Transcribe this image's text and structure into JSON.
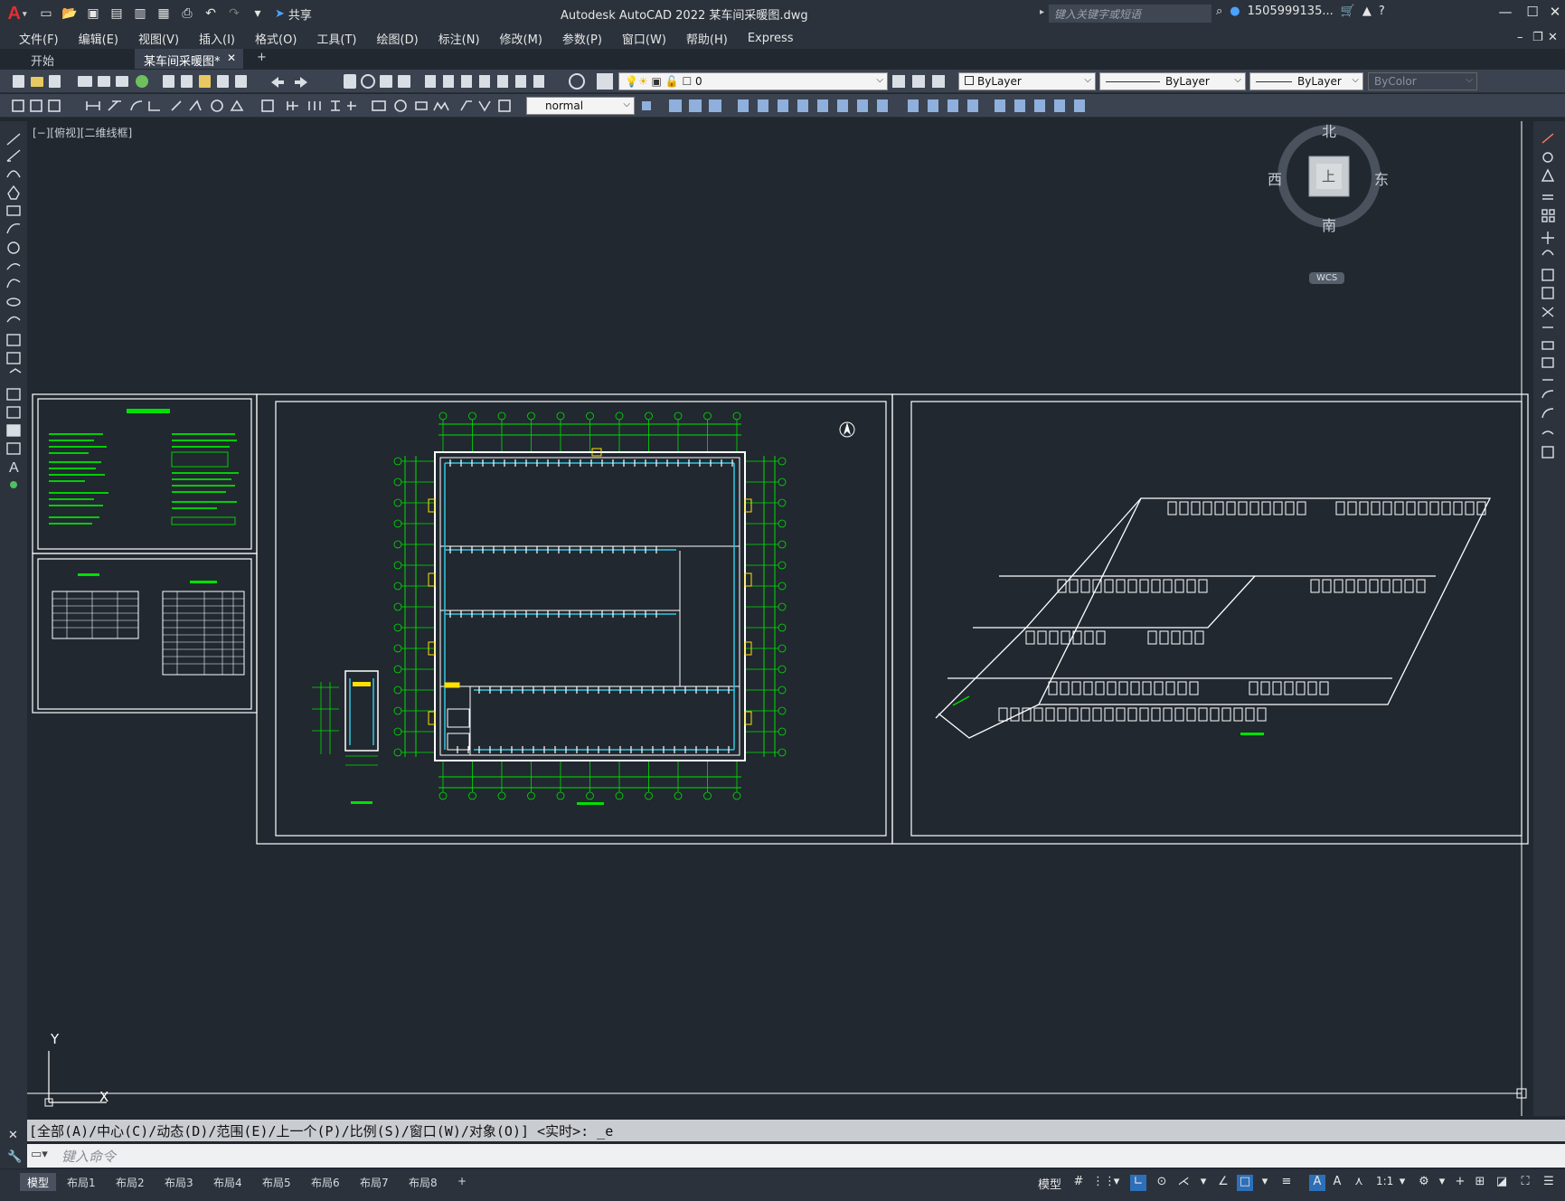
{
  "window": {
    "title": "Autodesk AutoCAD 2022    某车间采暖图.dwg",
    "search_placeholder": "键入关键字或短语",
    "user": "1505999135...",
    "share_label": "共享",
    "help_label": "?"
  },
  "menu": [
    "文件(F)",
    "编辑(E)",
    "视图(V)",
    "插入(I)",
    "格式(O)",
    "工具(T)",
    "绘图(D)",
    "标注(N)",
    "修改(M)",
    "参数(P)",
    "窗口(W)",
    "帮助(H)",
    "Express"
  ],
  "tabs": [
    {
      "label": "开始"
    },
    {
      "label": "某车间采暖图*"
    }
  ],
  "toolbar": {
    "layer_value": "0",
    "color_value": "ByLayer",
    "linetype_value": "ByLayer",
    "lineweight_value": "ByLayer",
    "plotstyle_value": "ByColor",
    "textstyle_value": "normal"
  },
  "viewport_label": "[−][俯视][二维线框]",
  "viewcube": {
    "north": "北",
    "south": "南",
    "east": "东",
    "west": "西",
    "face": "上",
    "wcs": "WCS"
  },
  "ucs": {
    "x": "X",
    "y": "Y"
  },
  "command": {
    "history": "[全部(A)/中心(C)/动态(D)/范围(E)/上一个(P)/比例(S)/窗口(W)/对象(O)] <实时>: _e",
    "placeholder": "键入命令"
  },
  "layouts": [
    "模型",
    "布局1",
    "布局2",
    "布局3",
    "布局4",
    "布局5",
    "布局6",
    "布局7",
    "布局8"
  ],
  "status": {
    "model_label": "模型",
    "scale": "1:1"
  },
  "colors": {
    "canvas": "#212830",
    "drawing_green": "#00e000",
    "drawing_white": "#ffffff",
    "pipe_cyan": "#30c8e0",
    "valve_yellow": "#ffe000",
    "accent_blue": "#2d6fb8"
  }
}
